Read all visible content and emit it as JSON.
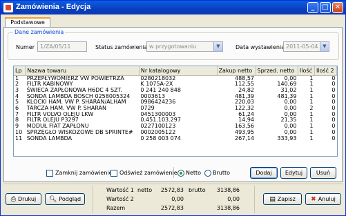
{
  "window": {
    "title": "Zamówienia - Edycja"
  },
  "tabs": [
    {
      "label": "Podstawowe"
    }
  ],
  "order_group": {
    "title": "Dane zamówienia",
    "number_label": "Numer",
    "number_value": "1/ZA/05/11",
    "status_label": "Status zamówienia",
    "status_value": "w przygotowaniu",
    "date_label": "Data wystawienia",
    "date_value": "2011-05-04"
  },
  "table": {
    "columns": [
      "Lp",
      "Nazwa towaru",
      "Nr katalogowy",
      "Zakup netto",
      "Sprzed. netto",
      "Ilość",
      "Ilość 2"
    ],
    "rows": [
      [
        "1",
        "PRZEPŁYWOMIERZ VW POWIETRZA",
        "0280218032",
        "488,57",
        "0,00",
        "1",
        "0"
      ],
      [
        "2",
        "FILTR KABINOWY",
        "K 1075A-2X",
        "112,55",
        "140,69",
        "1",
        "0"
      ],
      [
        "3",
        "ŚWIECA ZAPŁONOWA  H6DC  4 SZT.",
        "0 241 240 848",
        "24,82",
        "31,02",
        "1",
        "0"
      ],
      [
        "4",
        "SONDA LAMBDA BOSCH 0258005324",
        "0003613",
        "481,39",
        "481,39",
        "1",
        "0"
      ],
      [
        "5",
        "KLOCKI HAM. VW P. SHARAN/ALHAM",
        "0986424236",
        "220,03",
        "0,00",
        "1",
        "0"
      ],
      [
        "6",
        "TARCZA HAM. VW P. SHARAN",
        "0729",
        "122,32",
        "0,00",
        "2",
        "0"
      ],
      [
        "7",
        "FILTR VOLVO OLEJU LKW",
        "0451300003",
        "61,24",
        "0,00",
        "1",
        "0"
      ],
      [
        "8",
        "FILTR OLEJU P3297",
        "0.451.103.297",
        "14,94",
        "21,35",
        "1",
        "0"
      ],
      [
        "9",
        "MODUŁ FIAT ZAPŁONU",
        "0227100123",
        "163,56",
        "0,00",
        "1",
        "0"
      ],
      [
        "10",
        "SPRZĘGŁO WISKOZOWE DB SPRINTE#",
        "0002005122",
        "493,95",
        "0,00",
        "1",
        "0"
      ],
      [
        "11",
        "SONDA LAMBDA",
        "0 258 003 074",
        "267,14",
        "333,93",
        "1",
        "0"
      ]
    ]
  },
  "options": {
    "close_order_label": "Zamknij zamówienie",
    "refresh_order_label": "Odśwież zamówienie",
    "netto_label": "Netto",
    "brutto_label": "Brutto",
    "selected_price_mode": "Netto"
  },
  "row_buttons": {
    "add": "Dodaj",
    "edit": "Edytuj",
    "delete": "Usuń"
  },
  "summary": {
    "netto_label": "netto",
    "brutto_label": "brutto",
    "rows": [
      {
        "label": "Wartość 1",
        "netto": "2572,83",
        "brutto": "3138,86"
      },
      {
        "label": "Wartość 2",
        "netto": "0,00",
        "brutto": "0,00"
      },
      {
        "label": "Razem",
        "netto": "2572,83",
        "brutto": "3138,86"
      }
    ]
  },
  "footer_buttons": {
    "print": "Drukuj",
    "preview": "Podgląd",
    "save": "Zapisz",
    "cancel": "Anuluj"
  },
  "icons": {
    "print": "printer-icon",
    "preview": "magnifier-icon",
    "save": "save-icon",
    "cancel": "cancel-icon"
  }
}
